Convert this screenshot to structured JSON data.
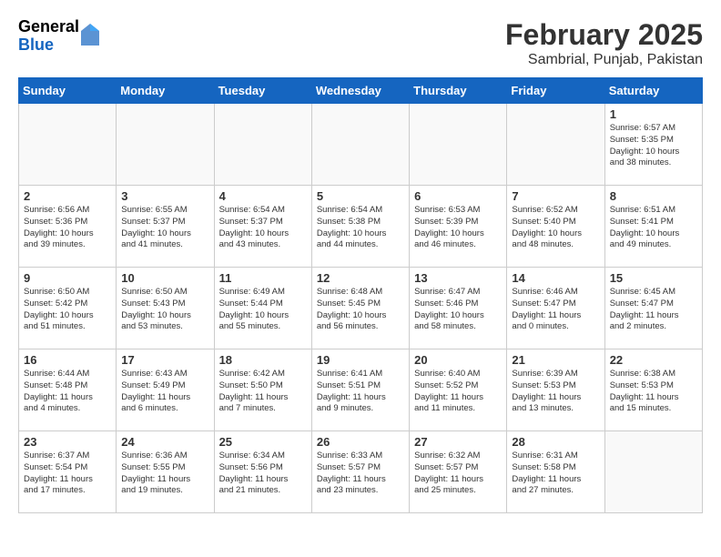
{
  "header": {
    "logo_general": "General",
    "logo_blue": "Blue",
    "title": "February 2025",
    "subtitle": "Sambrial, Punjab, Pakistan"
  },
  "weekdays": [
    "Sunday",
    "Monday",
    "Tuesday",
    "Wednesday",
    "Thursday",
    "Friday",
    "Saturday"
  ],
  "weeks": [
    [
      {
        "day": "",
        "info": ""
      },
      {
        "day": "",
        "info": ""
      },
      {
        "day": "",
        "info": ""
      },
      {
        "day": "",
        "info": ""
      },
      {
        "day": "",
        "info": ""
      },
      {
        "day": "",
        "info": ""
      },
      {
        "day": "1",
        "info": "Sunrise: 6:57 AM\nSunset: 5:35 PM\nDaylight: 10 hours\nand 38 minutes."
      }
    ],
    [
      {
        "day": "2",
        "info": "Sunrise: 6:56 AM\nSunset: 5:36 PM\nDaylight: 10 hours\nand 39 minutes."
      },
      {
        "day": "3",
        "info": "Sunrise: 6:55 AM\nSunset: 5:37 PM\nDaylight: 10 hours\nand 41 minutes."
      },
      {
        "day": "4",
        "info": "Sunrise: 6:54 AM\nSunset: 5:37 PM\nDaylight: 10 hours\nand 43 minutes."
      },
      {
        "day": "5",
        "info": "Sunrise: 6:54 AM\nSunset: 5:38 PM\nDaylight: 10 hours\nand 44 minutes."
      },
      {
        "day": "6",
        "info": "Sunrise: 6:53 AM\nSunset: 5:39 PM\nDaylight: 10 hours\nand 46 minutes."
      },
      {
        "day": "7",
        "info": "Sunrise: 6:52 AM\nSunset: 5:40 PM\nDaylight: 10 hours\nand 48 minutes."
      },
      {
        "day": "8",
        "info": "Sunrise: 6:51 AM\nSunset: 5:41 PM\nDaylight: 10 hours\nand 49 minutes."
      }
    ],
    [
      {
        "day": "9",
        "info": "Sunrise: 6:50 AM\nSunset: 5:42 PM\nDaylight: 10 hours\nand 51 minutes."
      },
      {
        "day": "10",
        "info": "Sunrise: 6:50 AM\nSunset: 5:43 PM\nDaylight: 10 hours\nand 53 minutes."
      },
      {
        "day": "11",
        "info": "Sunrise: 6:49 AM\nSunset: 5:44 PM\nDaylight: 10 hours\nand 55 minutes."
      },
      {
        "day": "12",
        "info": "Sunrise: 6:48 AM\nSunset: 5:45 PM\nDaylight: 10 hours\nand 56 minutes."
      },
      {
        "day": "13",
        "info": "Sunrise: 6:47 AM\nSunset: 5:46 PM\nDaylight: 10 hours\nand 58 minutes."
      },
      {
        "day": "14",
        "info": "Sunrise: 6:46 AM\nSunset: 5:47 PM\nDaylight: 11 hours\nand 0 minutes."
      },
      {
        "day": "15",
        "info": "Sunrise: 6:45 AM\nSunset: 5:47 PM\nDaylight: 11 hours\nand 2 minutes."
      }
    ],
    [
      {
        "day": "16",
        "info": "Sunrise: 6:44 AM\nSunset: 5:48 PM\nDaylight: 11 hours\nand 4 minutes."
      },
      {
        "day": "17",
        "info": "Sunrise: 6:43 AM\nSunset: 5:49 PM\nDaylight: 11 hours\nand 6 minutes."
      },
      {
        "day": "18",
        "info": "Sunrise: 6:42 AM\nSunset: 5:50 PM\nDaylight: 11 hours\nand 7 minutes."
      },
      {
        "day": "19",
        "info": "Sunrise: 6:41 AM\nSunset: 5:51 PM\nDaylight: 11 hours\nand 9 minutes."
      },
      {
        "day": "20",
        "info": "Sunrise: 6:40 AM\nSunset: 5:52 PM\nDaylight: 11 hours\nand 11 minutes."
      },
      {
        "day": "21",
        "info": "Sunrise: 6:39 AM\nSunset: 5:53 PM\nDaylight: 11 hours\nand 13 minutes."
      },
      {
        "day": "22",
        "info": "Sunrise: 6:38 AM\nSunset: 5:53 PM\nDaylight: 11 hours\nand 15 minutes."
      }
    ],
    [
      {
        "day": "23",
        "info": "Sunrise: 6:37 AM\nSunset: 5:54 PM\nDaylight: 11 hours\nand 17 minutes."
      },
      {
        "day": "24",
        "info": "Sunrise: 6:36 AM\nSunset: 5:55 PM\nDaylight: 11 hours\nand 19 minutes."
      },
      {
        "day": "25",
        "info": "Sunrise: 6:34 AM\nSunset: 5:56 PM\nDaylight: 11 hours\nand 21 minutes."
      },
      {
        "day": "26",
        "info": "Sunrise: 6:33 AM\nSunset: 5:57 PM\nDaylight: 11 hours\nand 23 minutes."
      },
      {
        "day": "27",
        "info": "Sunrise: 6:32 AM\nSunset: 5:57 PM\nDaylight: 11 hours\nand 25 minutes."
      },
      {
        "day": "28",
        "info": "Sunrise: 6:31 AM\nSunset: 5:58 PM\nDaylight: 11 hours\nand 27 minutes."
      },
      {
        "day": "",
        "info": ""
      }
    ]
  ]
}
